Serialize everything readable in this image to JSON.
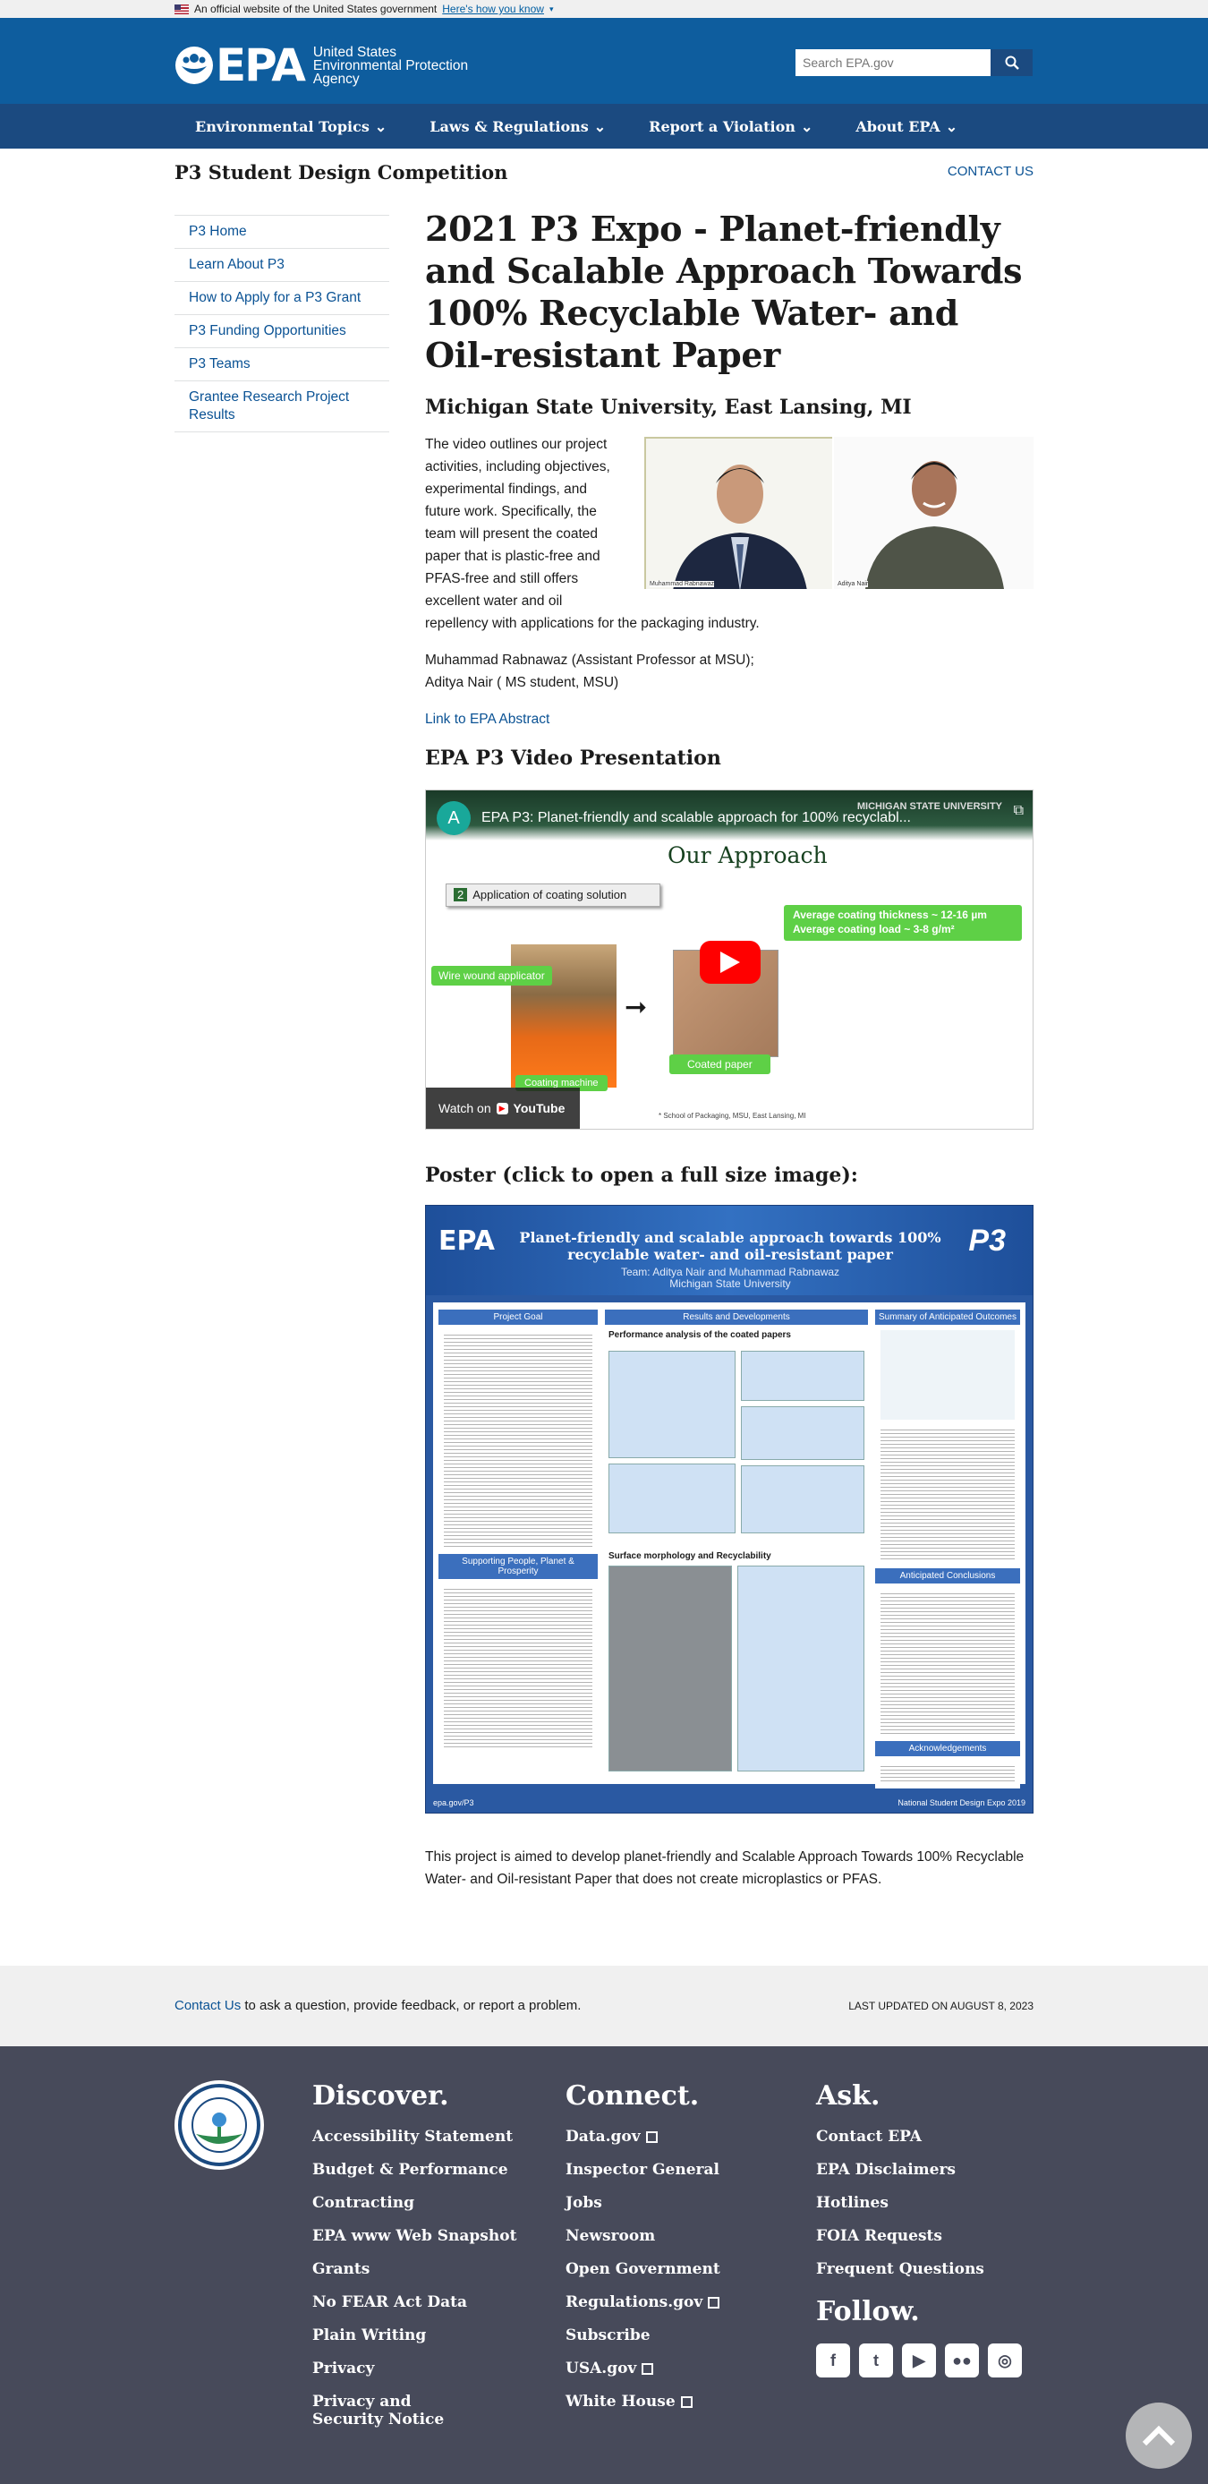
{
  "gov_banner": {
    "text": "An official website of the United States government",
    "link": "Here's how you know"
  },
  "header": {
    "logo_text": "EPA",
    "agency": "United States Environmental Protection Agency",
    "search_placeholder": "Search EPA.gov"
  },
  "nav": [
    {
      "label": "Environmental Topics"
    },
    {
      "label": "Laws & Regulations"
    },
    {
      "label": "Report a Violation"
    },
    {
      "label": "About EPA"
    }
  ],
  "subheader": {
    "title": "P3 Student Design Competition",
    "contact": "CONTACT US"
  },
  "sidebar": {
    "items": [
      {
        "label": "P3 Home"
      },
      {
        "label": "Learn About P3"
      },
      {
        "label": "How to Apply for a P3 Grant"
      },
      {
        "label": "P3 Funding Opportunities"
      },
      {
        "label": "P3 Teams"
      },
      {
        "label": "Grantee Research Project Results"
      }
    ]
  },
  "main": {
    "title": "2021 P3 Expo - Planet-friendly and Scalable Approach Towards 100% Recyclable Water- and Oil-resistant Paper",
    "subtitle": "Michigan State University, East Lansing, MI",
    "intro": "The video outlines our project activities, including objectives, experimental findings, and future work. Specifically, the team will present the coated paper that is plastic-free and PFAS-free and still offers excellent water and oil repellency with applications for the packaging industry.",
    "photo_caption_1": "Muhammad Rabnawaz",
    "photo_caption_2": "Aditya Nair",
    "team_line1": "Muhammad Rabnawaz (Assistant Professor at MSU);",
    "team_line2": "Aditya Nair ( MS student, MSU)",
    "abstract_link": "Link to EPA Abstract",
    "video_heading": "EPA P3 Video Presentation",
    "video": {
      "channel_initial": "A",
      "title": "EPA P3: Planet-friendly and scalable approach for 100% recyclabl...",
      "slide_title": "Our Approach",
      "step_label": "Application of coating solution",
      "step_num": "2",
      "coat_line1": "Average coating thickness ~ 12-16 µm",
      "coat_line2": "Average coating load ~ 3-8 g/m²",
      "wire_label": "Wire wound applicator",
      "machine_label": "Coating machine",
      "paper_label": "Coated paper",
      "footer": "* School of Packaging, MSU, East Lansing, MI",
      "watch_on": "Watch on",
      "youtube": "YouTube",
      "msu": "MICHIGAN STATE UNIVERSITY"
    },
    "poster_heading": "Poster (click to open a full size image):",
    "poster": {
      "logo": "EPA",
      "title": "Planet-friendly and scalable approach towards 100% recyclable water- and oil-resistant paper",
      "team": "Team: Aditya Nair and Muhammad Rabnawaz",
      "school": "Michigan State University",
      "col1": "Project Goal",
      "col2": "Results and Developments",
      "col3": "Summary of Anticipated Outcomes",
      "col1b": "Supporting People, Planet & Prosperity",
      "col2b": "Surface morphology and Recyclability",
      "col3b": "Anticipated Conclusions",
      "col3c": "Acknowledgements",
      "perf": "Performance analysis of the coated papers",
      "foot_left": "epa.gov/P3",
      "foot_right": "National Student Design Expo 2019",
      "p3": "P3"
    },
    "closing": "This project is aimed to develop planet-friendly and Scalable Approach Towards 100% Recyclable Water- and Oil-resistant Paper that does not create microplastics or PFAS."
  },
  "feedback": {
    "link": "Contact Us",
    "text": " to ask a question, provide feedback, or report a problem.",
    "updated": "LAST UPDATED ON AUGUST 8, 2023"
  },
  "footer": {
    "discover": {
      "heading": "Discover.",
      "links": [
        "Accessibility Statement",
        "Budget & Performance",
        "Contracting",
        "EPA www Web Snapshot",
        "Grants",
        "No FEAR Act Data",
        "Plain Writing",
        "Privacy",
        "Privacy and Security Notice"
      ]
    },
    "connect": {
      "heading": "Connect.",
      "links": [
        "Data.gov",
        "Inspector General",
        "Jobs",
        "Newsroom",
        "Open Government",
        "Regulations.gov",
        "Subscribe",
        "USA.gov",
        "White House"
      ],
      "external": [
        true,
        false,
        false,
        false,
        false,
        true,
        false,
        true,
        true
      ]
    },
    "ask": {
      "heading": "Ask.",
      "links": [
        "Contact EPA",
        "EPA Disclaimers",
        "Hotlines",
        "FOIA Requests",
        "Frequent Questions"
      ]
    },
    "follow": {
      "heading": "Follow.",
      "icons": [
        "facebook-icon",
        "twitter-icon",
        "youtube-icon",
        "flickr-icon",
        "instagram-icon"
      ]
    }
  },
  "colors": {
    "header": "#0e5d9e",
    "nav": "#1b4a80",
    "footer": "#474a5a",
    "link": "#0a5294"
  }
}
